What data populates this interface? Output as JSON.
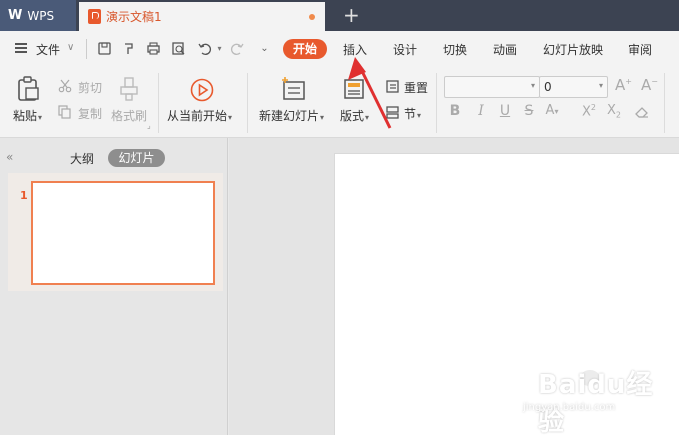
{
  "titlebar": {
    "app_tab": "WPS",
    "doc_tab": "演示文稿1",
    "new_tab_icon": "plus-icon"
  },
  "menubar": {
    "file_label": "文件",
    "tabs": [
      "开始",
      "插入",
      "设计",
      "切换",
      "动画",
      "幻灯片放映",
      "审阅"
    ],
    "active_tab": "开始",
    "accent": "#e8592d",
    "quick_access_icons": [
      "save-icon",
      "format-painter-icon",
      "print-icon",
      "print-preview-icon",
      "undo-icon",
      "redo-icon",
      "more-icon"
    ]
  },
  "ribbon": {
    "paste_label": "粘贴",
    "cut_label": "剪切",
    "copy_label": "复制",
    "format_painter_label": "格式刷",
    "from_current_label": "从当前开始",
    "new_slide_label": "新建幻灯片",
    "layout_label": "版式",
    "reset_label": "重置",
    "section_label": "节",
    "font_name_value": "",
    "font_size_value": "0"
  },
  "panel": {
    "outline_tab": "大纲",
    "slides_tab": "幻灯片",
    "slide_number": "1"
  },
  "watermark": {
    "text": "Baidu经验",
    "sub": "jingyan.baidu.com"
  }
}
